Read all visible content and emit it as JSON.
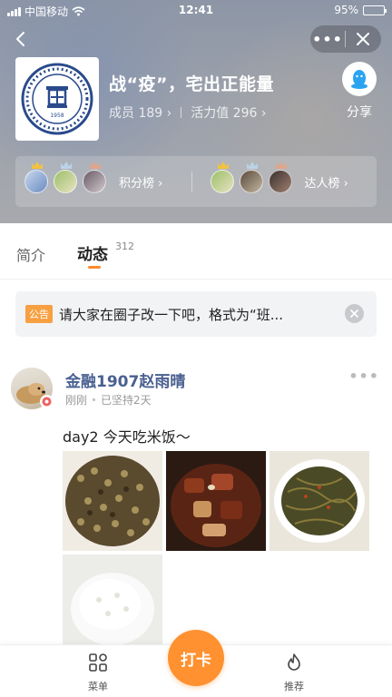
{
  "status_bar": {
    "carrier": "中国移动",
    "time": "12:41",
    "battery": "95%",
    "battery_level": 0.95
  },
  "group": {
    "title": "战“疫”，宅出正能量",
    "members": "成员 189 ›",
    "vitality": "活力值 296 ›",
    "share_label": "分享"
  },
  "rankings": {
    "points_label": "积分榜 ›",
    "experts_label": "达人榜 ›"
  },
  "tabs": {
    "intro": "简介",
    "feed": "动态",
    "feed_count": "312"
  },
  "notice": {
    "tag": "公告",
    "text": "请大家在圈子改一下吧，格式为“班..."
  },
  "post": {
    "author": "金融1907赵雨晴",
    "time": "刚刚",
    "streak": "已坚持2天",
    "content": "day2 今天吃米饭～"
  },
  "bottom_nav": {
    "menu_label": "菜单",
    "checkin_label": "打卡",
    "recommend_label": "推荐"
  },
  "colors": {
    "accent": "#ff9130",
    "author_name": "#4a6090",
    "notice_tag": "#f7a042"
  }
}
